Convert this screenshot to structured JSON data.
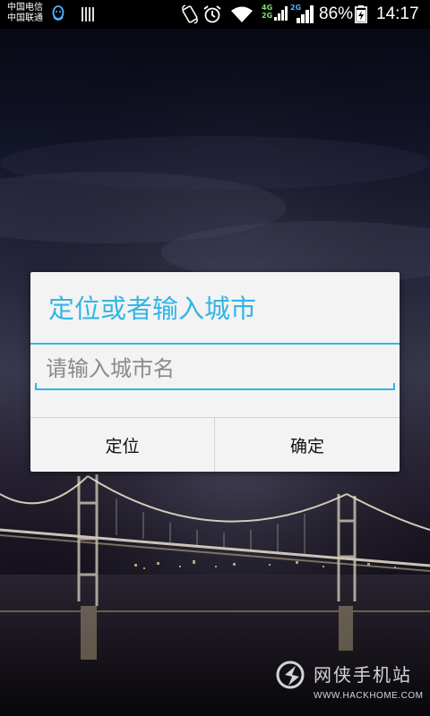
{
  "status_bar": {
    "carrier_1": "中国电信",
    "carrier_2": "中国联通",
    "network_1": "4G",
    "network_1b": "2G",
    "network_2": "2G",
    "battery": "86%",
    "time": "14:17",
    "icons": [
      "qq-icon",
      "signal-bars-icon",
      "rotate-icon",
      "alarm-icon",
      "wifi-icon",
      "cell-signal-icon",
      "battery-charging-icon"
    ]
  },
  "dialog": {
    "title": "定位或者输入城市",
    "input": {
      "value": "",
      "placeholder": "请输入城市名"
    },
    "buttons": {
      "locate": "定位",
      "confirm": "确定"
    }
  },
  "watermark": {
    "name": "网侠手机站",
    "url": "WWW.HACKHOME.COM"
  },
  "colors": {
    "accent": "#33b5e5",
    "dialog_bg": "#f3f3f3",
    "status_bar_bg": "#000000"
  }
}
